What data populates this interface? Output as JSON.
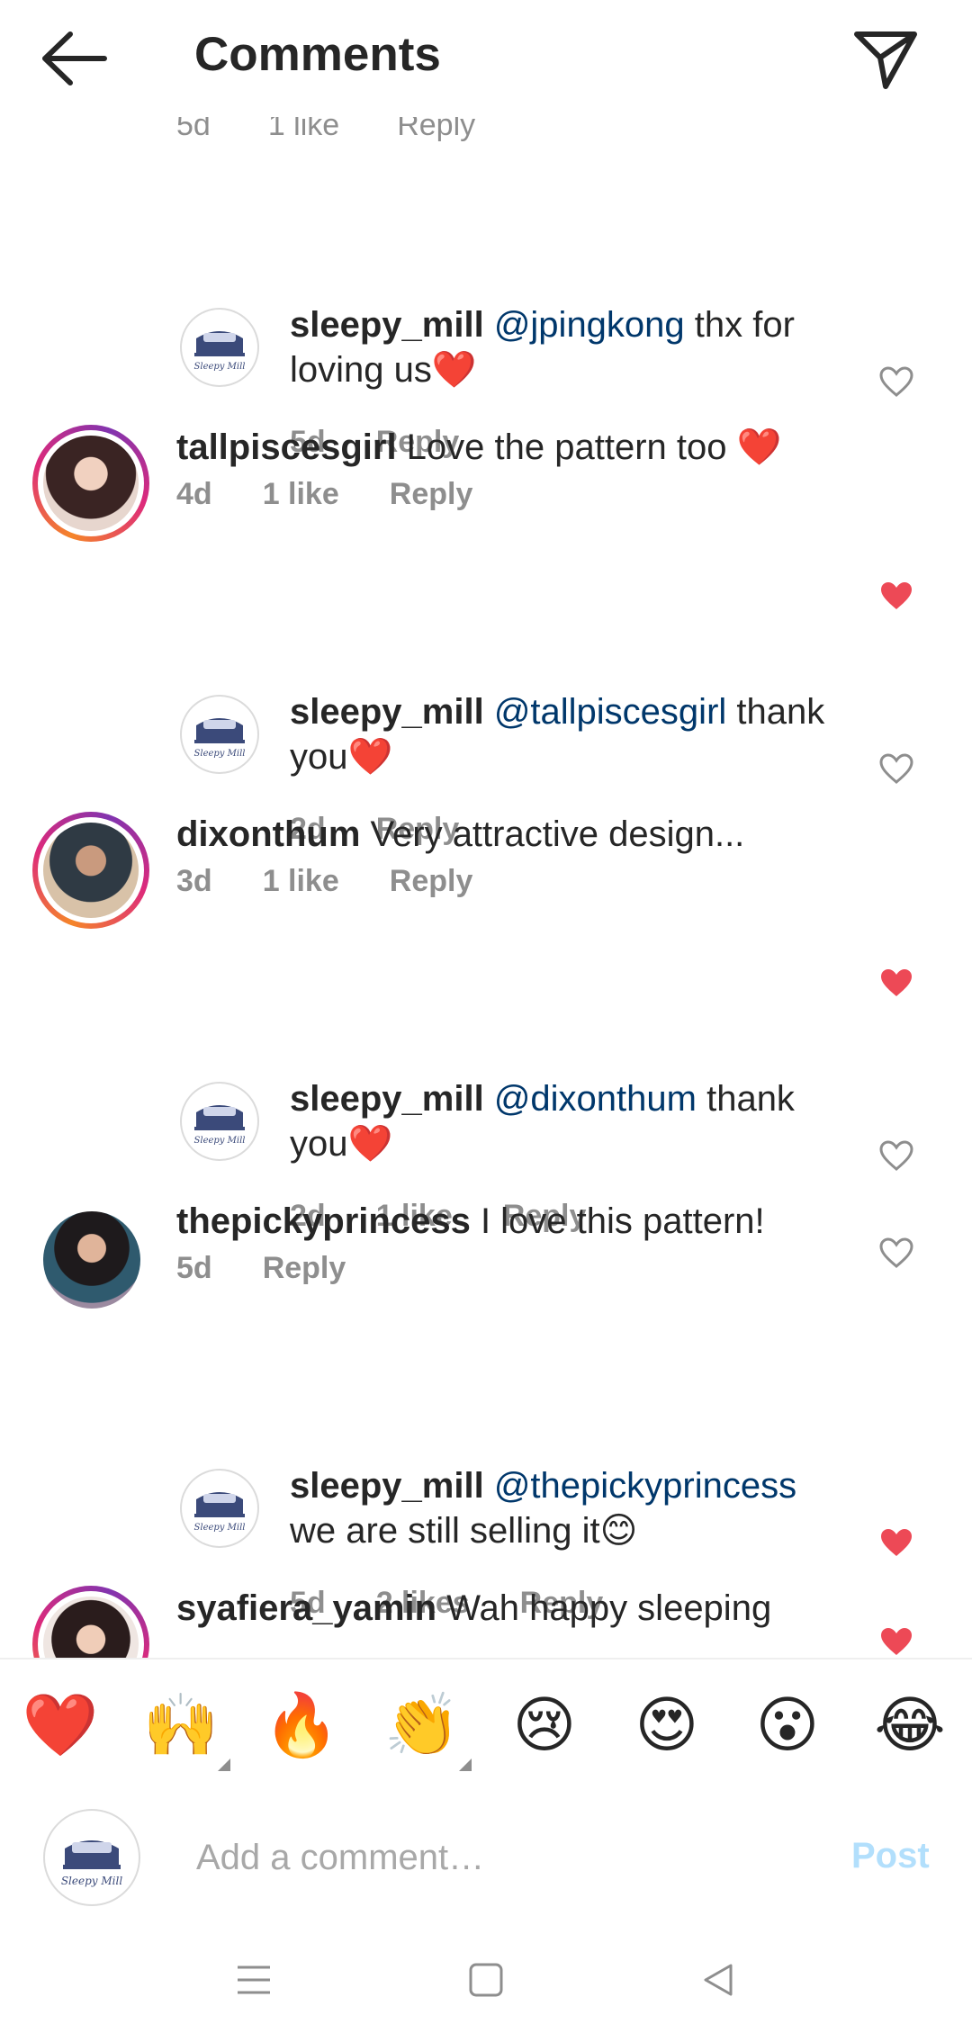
{
  "header": {
    "title": "Comments"
  },
  "partial_meta": {
    "time": "5d",
    "likes": "1 like",
    "reply": "Reply"
  },
  "comments": [
    {
      "user": "sleepy_mill",
      "mention": "@jpingkong",
      "text_a": " thx for",
      "text_b": "loving us❤️",
      "time": "5d",
      "likes": "",
      "reply": "Reply",
      "liked": false
    },
    {
      "user": "tallpiscesgirl",
      "text": " Love the pattern too ❤️",
      "time": "4d",
      "likes": "1 like",
      "reply": "Reply",
      "liked": true
    },
    {
      "user": "sleepy_mill",
      "mention": "@tallpiscesgirl",
      "text_a": " thank",
      "text_b": "you❤️",
      "time": "2d",
      "likes": "",
      "reply": "Reply",
      "liked": false
    },
    {
      "user": "dixonthum",
      "text": " Very attractive design...",
      "time": "3d",
      "likes": "1 like",
      "reply": "Reply",
      "liked": true
    },
    {
      "user": "sleepy_mill",
      "mention": "@dixonthum",
      "text_a": " thank",
      "text_b": "you❤️",
      "time": "2d",
      "likes": "1 like",
      "reply": "Reply",
      "liked": false
    },
    {
      "user": "thepickyprincess",
      "text": " I love this pattern!",
      "time": "5d",
      "likes": "",
      "reply": "Reply",
      "liked": false
    },
    {
      "user": "sleepy_mill",
      "mention": "@thepickyprincess",
      "text_a": "",
      "text_b": "we are still selling it😊",
      "time": "5d",
      "likes": "2 likes",
      "reply": "Reply",
      "liked": true
    },
    {
      "user": "syafiera_yamin",
      "text": " Wah happy sleeping",
      "liked": true
    }
  ],
  "emojis": [
    "❤️",
    "🙌",
    "🔥",
    "👏",
    "😢",
    "😍",
    "😮",
    "😂"
  ],
  "composer": {
    "placeholder": "Add a comment…",
    "post_label": "Post",
    "brand_text": "Sleepy Mill"
  },
  "colors": {
    "liked_heart": "#ed4956",
    "mention": "#00376b",
    "post_disabled": "#b2dffc"
  }
}
